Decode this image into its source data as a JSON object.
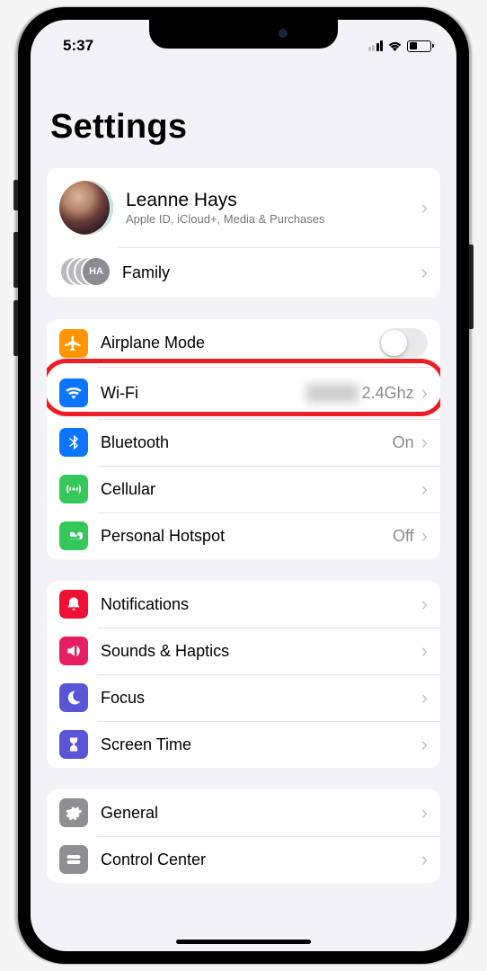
{
  "status": {
    "time": "5:37"
  },
  "title": "Settings",
  "account": {
    "name": "Leanne Hays",
    "subtitle": "Apple ID, iCloud+, Media & Purchases",
    "family_label": "Family",
    "family_initials": "HA"
  },
  "connectivity": {
    "airplane": {
      "label": "Airplane Mode",
      "on": false
    },
    "wifi": {
      "label": "Wi-Fi",
      "value_suffix": "2.4Ghz"
    },
    "bluetooth": {
      "label": "Bluetooth",
      "value": "On"
    },
    "cellular": {
      "label": "Cellular"
    },
    "hotspot": {
      "label": "Personal Hotspot",
      "value": "Off"
    }
  },
  "alerts": {
    "notifications": {
      "label": "Notifications"
    },
    "sounds": {
      "label": "Sounds & Haptics"
    },
    "focus": {
      "label": "Focus"
    },
    "screen_time": {
      "label": "Screen Time"
    }
  },
  "system": {
    "general": {
      "label": "General"
    },
    "control_center": {
      "label": "Control Center"
    }
  },
  "colors": {
    "airplane": "#ff9500",
    "wifi": "#0b75ff",
    "bluetooth": "#0b75ff",
    "cellular": "#34c759",
    "hotspot": "#34c759",
    "notifications": "#ee1133",
    "sounds": "#e61e62",
    "focus": "#5856d6",
    "screen_time": "#5856d6"
  }
}
